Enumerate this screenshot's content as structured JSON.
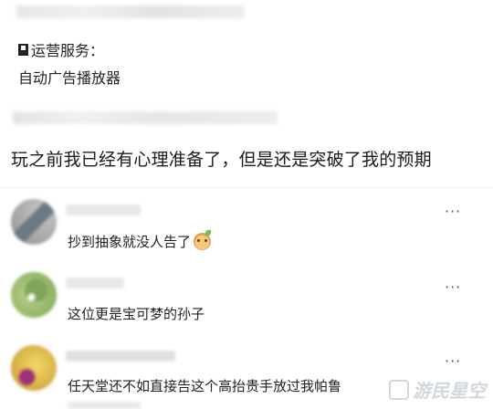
{
  "post1": {
    "prefix": "运营服务：",
    "body": "自动广告播放器"
  },
  "post2": {
    "body": "玩之前我已经有心理准备了，但是还是突破了我的预期"
  },
  "comments": [
    {
      "text": "抄到抽象就没人告了",
      "more": "···"
    },
    {
      "text": "这位更是宝可梦的孙子",
      "more": "···"
    },
    {
      "text": "任天堂还不如直接告这个高抬贵手放过我帕鲁",
      "more": "···"
    }
  ],
  "watermark": {
    "text": "游民星空"
  }
}
